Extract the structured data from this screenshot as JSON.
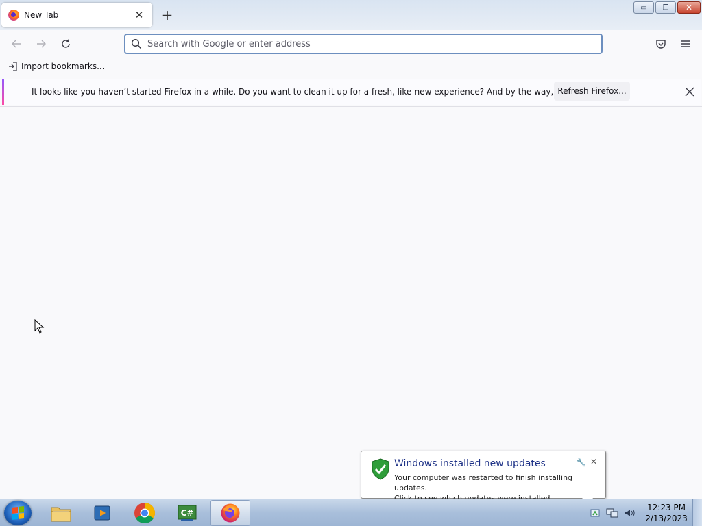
{
  "browser": {
    "tab": {
      "title": "New Tab",
      "close": "✕"
    },
    "new_tab": "+",
    "window_controls": {
      "minimize": "▭",
      "restore": "❐",
      "close": "✕"
    },
    "search": {
      "placeholder": "Search with Google or enter address",
      "value": ""
    },
    "bookmarks": {
      "import_label": "Import bookmarks..."
    },
    "notification": {
      "message": "It looks like you haven’t started Firefox in a while. Do you want to clean it up for a fresh, like-new experience? And by the way, welcome back!",
      "button_label": "Refresh Firefox...",
      "accent_colors": [
        "#9059ff",
        "#ff4aa2"
      ]
    }
  },
  "balloon": {
    "title": "Windows installed new updates",
    "body_line1": "Your computer was restarted to finish installing updates.",
    "body_line2": "Click to see which updates were installed.",
    "close": "✕",
    "pin": "🔧"
  },
  "taskbar": {
    "items": [
      "windows-explorer",
      "media-player",
      "google-chrome",
      "csharp-ide",
      "firefox"
    ],
    "active_item": "firefox",
    "clock": {
      "time": "12:23 PM",
      "date": "2/13/2023"
    }
  }
}
